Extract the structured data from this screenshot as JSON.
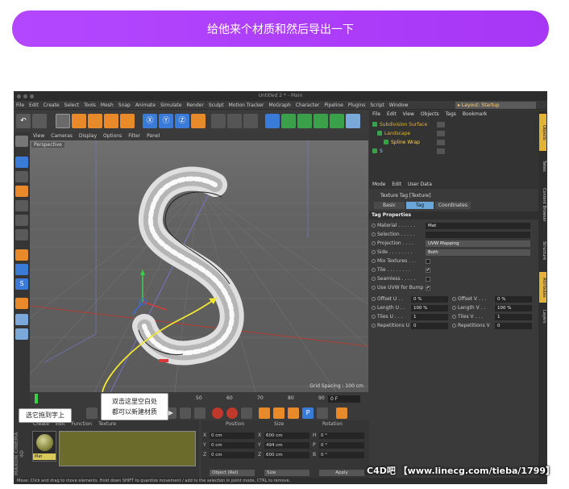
{
  "banner": {
    "text": "给他来个材质和然后导出一下"
  },
  "window": {
    "title": "Untitled 2 * - Main"
  },
  "menubar": {
    "items": [
      "File",
      "Edit",
      "Create",
      "Select",
      "Tools",
      "Mesh",
      "Snap",
      "Animate",
      "Simulate",
      "Render",
      "Sculpt",
      "Motion Tracker",
      "MoGraph",
      "Character",
      "Pipeline",
      "Plugins",
      "Script",
      "Window"
    ],
    "layout_label": "▸ Layout:",
    "layout_value": "Startup"
  },
  "viewport": {
    "menu": [
      "View",
      "Cameras",
      "Display",
      "Options",
      "Filter",
      "Panel"
    ],
    "label": "Perspective",
    "grid_spacing": "Grid Spacing : 100 cm"
  },
  "timeline": {
    "ticks": [
      "0",
      "50",
      "60",
      "70",
      "80",
      "90"
    ],
    "frame": "0 F"
  },
  "materials": {
    "menu": [
      "Create",
      "Edit",
      "Function",
      "Texture"
    ],
    "material_name": "Mat"
  },
  "coordinates": {
    "headers": [
      "Position",
      "Size",
      "Rotation"
    ],
    "rows": [
      {
        "axis": "X",
        "pos": "0 cm",
        "size_axis": "X",
        "size": "600 cm",
        "rot_axis": "H",
        "rot": "0 °"
      },
      {
        "axis": "Y",
        "pos": "0 cm",
        "size_axis": "Y",
        "size": "494 cm",
        "rot_axis": "P",
        "rot": "0 °"
      },
      {
        "axis": "Z",
        "pos": "0 cm",
        "size_axis": "Z",
        "size": "600 cm",
        "rot_axis": "B",
        "rot": "0 °"
      }
    ],
    "mode": "Object (Rel)",
    "size_mode": "Size",
    "apply": "Apply"
  },
  "objects": {
    "menu": [
      "File",
      "Edit",
      "View",
      "Objects",
      "Tags",
      "Bookmark"
    ],
    "items": [
      {
        "name": "Subdivision Surface",
        "color": "#e6b13a"
      },
      {
        "name": "Landscape",
        "color": "#e6b13a"
      },
      {
        "name": "Spline Wrap",
        "color": "#ffd34d"
      },
      {
        "name": "S",
        "color": "#9fd0ff"
      }
    ]
  },
  "attributes": {
    "menu": [
      "Mode",
      "Edit",
      "User Data"
    ],
    "tag_title": "Texture Tag [Texture]",
    "tabs": [
      "Basic",
      "Tag",
      "Coordinates"
    ],
    "active_tab": "Tag",
    "section": "Tag Properties",
    "props": [
      {
        "label": "Material . . . . . .",
        "value": "Mat",
        "kind": "field"
      },
      {
        "label": "Selection . . . . .",
        "value": "",
        "kind": "field"
      },
      {
        "label": "Projection . . . .",
        "value": "UVW Mapping",
        "kind": "drop"
      },
      {
        "label": "Side . . . . . . . .",
        "value": "Both",
        "kind": "drop"
      },
      {
        "label": "Mix Textures . . .",
        "checked": "",
        "kind": "check"
      },
      {
        "label": "Tile . . . . . . . .",
        "checked": "✔",
        "kind": "check"
      },
      {
        "label": "Seamless . . . . .",
        "checked": "",
        "kind": "check"
      },
      {
        "label": "Use UVW for Bump",
        "checked": "✔",
        "kind": "check"
      }
    ],
    "pairs": [
      {
        "l1": "Offset U . .",
        "v1": "0 %",
        "l2": "Offset V . . .",
        "v2": "0 %"
      },
      {
        "l1": "Length U . .",
        "v1": "100 %",
        "l2": "Length V . .",
        "v2": "100 %"
      },
      {
        "l1": "Tiles U . . .",
        "v1": "1",
        "l2": "Tiles V . . .",
        "v2": "1"
      },
      {
        "l1": "Repetitions U",
        "v1": "0",
        "l2": "Repetitions V",
        "v2": "0"
      }
    ]
  },
  "side_tabs": [
    "Objects",
    "Takes",
    "Content Browser",
    "Structure",
    "Attributes",
    "Layers"
  ],
  "statusbar": {
    "text": "Move: Click and drag to move elements. Hold down SHIFT to quantize movement / add to the selection in point mode, CTRL to remove."
  },
  "callouts": {
    "drag": "选它拖到字上",
    "dbl_line1": "双击这里空白处",
    "dbl_line2": "都可以新建材质"
  },
  "watermark": {
    "text": "C4D吧 【www.linecg.com/tieba/1799】"
  },
  "maxon": {
    "text": "MAXON CINEMA 4D"
  },
  "colors": {
    "accent": "#b347ff",
    "orange": "#e6b13a",
    "blue_tab": "#6aa6d8"
  }
}
